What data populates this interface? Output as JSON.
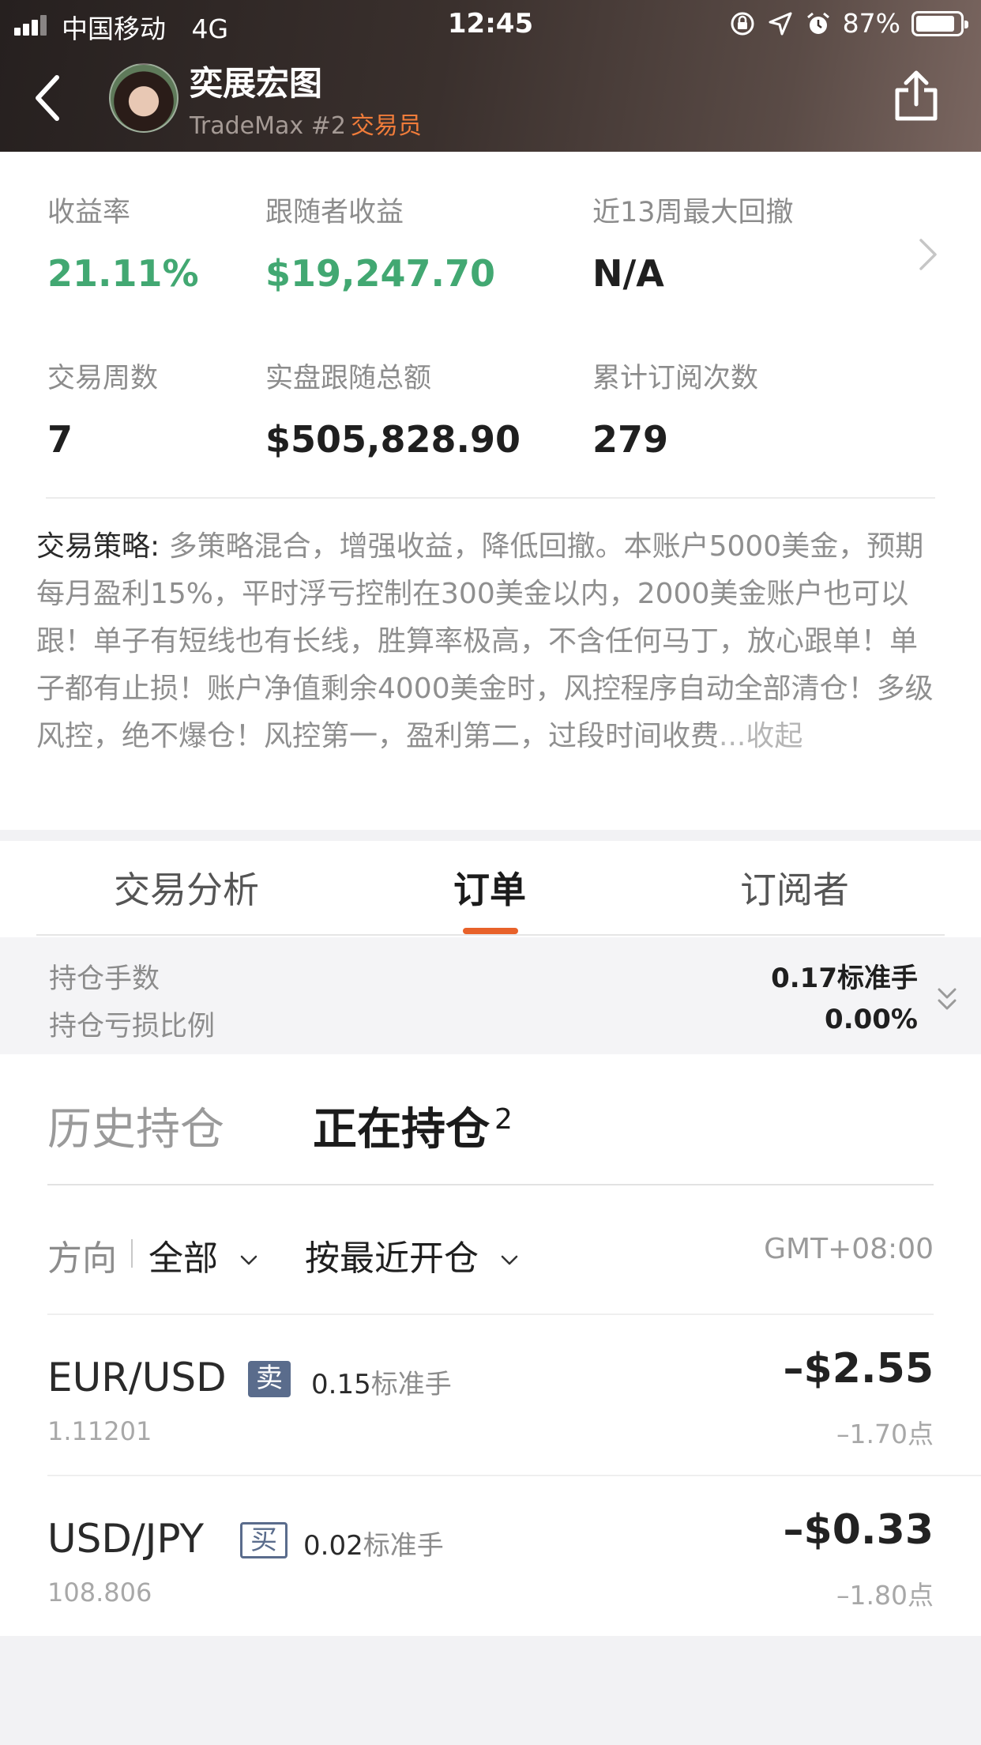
{
  "status_bar": {
    "carrier": "中国移动",
    "network": "4G",
    "time": "12:45",
    "battery": "87%",
    "icons": [
      "rotation-lock-icon",
      "location-arrow-icon",
      "alarm-icon",
      "battery-icon"
    ]
  },
  "header": {
    "trader_name": "奕展宏图",
    "platform": "TradeMax #2",
    "role": "交易员"
  },
  "stats": [
    {
      "label": "收益率",
      "value": "21.11%",
      "color": "#42a872"
    },
    {
      "label": "跟随者收益",
      "value": "$19,247.70",
      "color": "#42a872"
    },
    {
      "label": "近13周最大回撤",
      "value": "N/A"
    },
    {
      "label": "交易周数",
      "value": "7"
    },
    {
      "label": "实盘跟随总额",
      "value": "$505,828.90"
    },
    {
      "label": "累计订阅次数",
      "value": "279"
    }
  ],
  "strategy": {
    "label": "交易策略:",
    "text": " 多策略混合，增强收益，降低回撤。本账户5000美金，预期每月盈利15%，平时浮亏控制在300美金以内，2000美金账户也可以跟！单子有短线也有长线，胜算率极高，不含任何马丁，放心跟单！单子都有止损！账户净值剩余4000美金时，风控程序自动全部清仓！多级风控，绝不爆仓！风控第一，盈利第二，过段时间收费",
    "collapse": "...收起"
  },
  "tabs": [
    {
      "label": "交易分析",
      "active": false
    },
    {
      "label": "订单",
      "active": true
    },
    {
      "label": "订阅者",
      "active": false
    }
  ],
  "summary": {
    "lots_label": "持仓手数",
    "lots_value": "0.17标准手",
    "loss_label": "持仓亏损比例",
    "loss_value": "0.00%"
  },
  "positions": {
    "history_tab": "历史持仓",
    "open_tab": "正在持仓",
    "open_count": "2",
    "direction_label": "方向",
    "direction_value": "全部",
    "sort_value": "按最近开仓",
    "timezone": "GMT+08:00",
    "orders": [
      {
        "pair": "EUR/USD",
        "side": "卖",
        "lots": "0.15",
        "unit": "标准手",
        "price": "1.11201",
        "pnl": "–$2.55",
        "points": "–1.70点"
      },
      {
        "pair": "USD/JPY",
        "side": "买",
        "lots": "0.02",
        "unit": "标准手",
        "price": "108.806",
        "pnl": "–$0.33",
        "points": "–1.80点"
      }
    ]
  },
  "colors": {
    "accent_orange": "#e8622a",
    "profit_green": "#42a872",
    "sell_badge": "#5a6c8c"
  }
}
